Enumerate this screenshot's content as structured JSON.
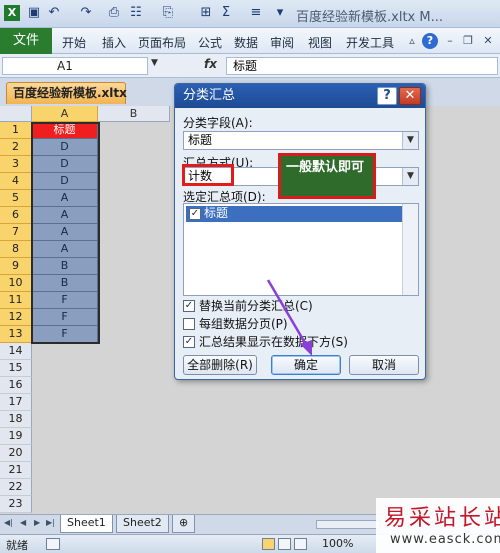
{
  "title_bar": {
    "doc_title": "百度经验新模板.xltx M..."
  },
  "ribbon": {
    "file": "文件",
    "tabs": [
      "开始",
      "插入",
      "页面布局",
      "公式",
      "数据",
      "审阅",
      "视图",
      "开发工具"
    ]
  },
  "formula_bar": {
    "cell_ref": "A1",
    "fx": "fx",
    "content": "标题"
  },
  "workbook_tab": "百度经验新模板.xltx",
  "sheet": {
    "columns": [
      "A",
      "B"
    ],
    "rows": [
      "1",
      "2",
      "3",
      "4",
      "5",
      "6",
      "7",
      "8",
      "9",
      "10",
      "11",
      "12",
      "13",
      "14",
      "15",
      "16",
      "17",
      "18",
      "19",
      "20",
      "21",
      "22",
      "23"
    ],
    "column_a": [
      "标题",
      "D",
      "D",
      "D",
      "A",
      "A",
      "A",
      "A",
      "B",
      "B",
      "F",
      "F",
      "F"
    ]
  },
  "dialog": {
    "title": "分类汇总",
    "help": "?",
    "close": "✕",
    "field_label": "分类字段(A):",
    "field_value": "标题",
    "func_label": "汇总方式(U):",
    "func_value": "计数",
    "items_label": "选定汇总项(D):",
    "items": [
      "标题"
    ],
    "checks": [
      {
        "label": "替换当前分类汇总(C)",
        "checked": true
      },
      {
        "label": "每组数据分页(P)",
        "checked": false
      },
      {
        "label": "汇总结果显示在数据下方(S)",
        "checked": true
      }
    ],
    "remove_all": "全部删除(R)",
    "ok": "确定",
    "cancel": "取消"
  },
  "annotation": {
    "note": "一般默认即可",
    "colors": {
      "box": "#e21b1b",
      "note_bg": "#2f6b2a",
      "arrow": "#8a3fd6"
    }
  },
  "sheet_tabs": [
    "Sheet1",
    "Sheet2"
  ],
  "status": {
    "ready": "就绪",
    "zoom": "100%"
  },
  "watermark": {
    "brand": "易采站长站",
    "url": "www.easck.com"
  }
}
